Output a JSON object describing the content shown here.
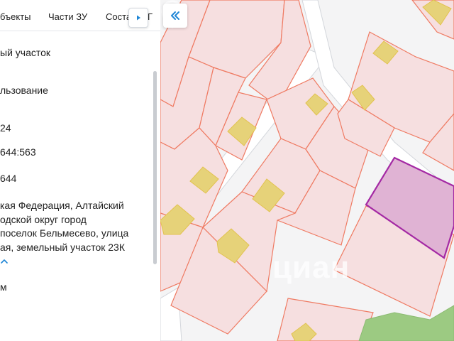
{
  "tabs": {
    "objects_label": "бъекты",
    "parts_label": "Части ЗУ",
    "composition_label": "Соста",
    "overflow_label": "Г"
  },
  "details": {
    "category": "ый участок",
    "usage": "льзование",
    "area_fragment": "24",
    "cadastral_number": "644:563",
    "quarter_number": "644",
    "address_lines": [
      "кая Федерация, Алтайский",
      "одской округ город",
      "поселок Бельмесево, улица",
      "ая, земельный участок 23К"
    ],
    "units_fragment": "м"
  },
  "map": {
    "watermark_text": "циан",
    "colors": {
      "parcel_fill": "#f6dfe0",
      "parcel_stroke": "#ef7a62",
      "building_fill": "#e6d279",
      "building_stroke": "#e2c24f",
      "selected_fill": "#e0b3d4",
      "selected_stroke": "#a429a4",
      "road_fill": "#ffffff",
      "road_stroke": "#d3d6db",
      "vegetation": "#9cca82",
      "accent": "#1f86d6"
    }
  },
  "icons": {
    "tab_next": "triangle-right-icon",
    "collapse": "double-chevron-left-icon",
    "expand_address": "chevron-up-icon"
  }
}
